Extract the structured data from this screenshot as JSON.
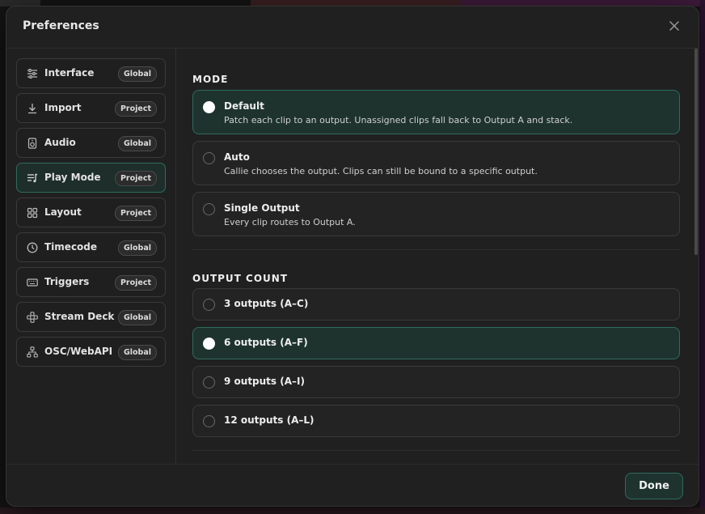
{
  "dialog": {
    "title": "Preferences",
    "done_label": "Done"
  },
  "sidebar": {
    "items": [
      {
        "label": "Interface",
        "badge": "Global",
        "icon": "sliders-icon"
      },
      {
        "label": "Import",
        "badge": "Project",
        "icon": "download-icon"
      },
      {
        "label": "Audio",
        "badge": "Global",
        "icon": "speaker-icon"
      },
      {
        "label": "Play Mode",
        "badge": "Project",
        "icon": "playlist-icon",
        "active": true
      },
      {
        "label": "Layout",
        "badge": "Project",
        "icon": "grid-icon"
      },
      {
        "label": "Timecode",
        "badge": "Global",
        "icon": "clock-icon"
      },
      {
        "label": "Triggers",
        "badge": "Project",
        "icon": "keyboard-icon"
      },
      {
        "label": "Stream Deck",
        "badge": "Global",
        "icon": "gamepad-icon"
      },
      {
        "label": "OSC/WebAPI",
        "badge": "Global",
        "icon": "network-icon"
      }
    ]
  },
  "mode": {
    "title": "MODE",
    "options": [
      {
        "label": "Default",
        "description": "Patch each clip to an output. Unassigned clips fall back to Output A and stack.",
        "selected": true
      },
      {
        "label": "Auto",
        "description": "Callie chooses the output. Clips can still be bound to a specific output.",
        "selected": false
      },
      {
        "label": "Single Output",
        "description": "Every clip routes to Output A.",
        "selected": false
      }
    ]
  },
  "output_count": {
    "title": "OUTPUT COUNT",
    "options": [
      {
        "label": "3 outputs (A–C)",
        "selected": false
      },
      {
        "label": "6 outputs (A–F)",
        "selected": true
      },
      {
        "label": "9 outputs (A–I)",
        "selected": false
      },
      {
        "label": "12 outputs (A–L)",
        "selected": false
      }
    ]
  },
  "colors": {
    "accent": "#2f6b5d",
    "selected_bg": "#1e332e",
    "panel_bg": "#202020"
  }
}
